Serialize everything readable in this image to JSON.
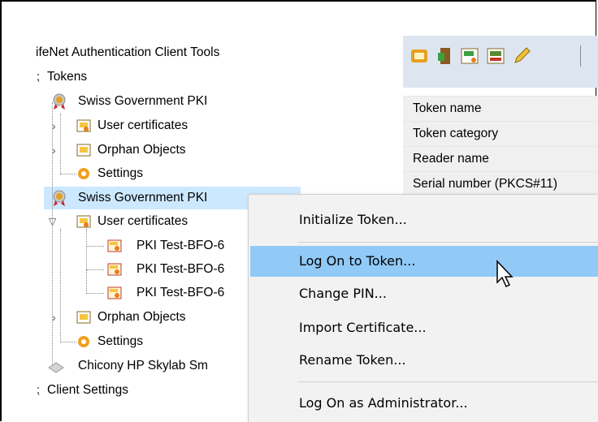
{
  "tree": {
    "root_label": "ifeNet Authentication Client Tools",
    "tokens_label": "Tokens",
    "token1": {
      "label": "Swiss Government PKI",
      "user_certs": "User certificates",
      "orphan": "Orphan Objects",
      "settings": "Settings"
    },
    "token2": {
      "label": "Swiss Government PKI",
      "user_certs": "User certificates",
      "certs": [
        "PKI Test-BFO-6",
        "PKI Test-BFO-6",
        "PKI Test-BFO-6"
      ],
      "orphan": "Orphan Objects",
      "settings": "Settings"
    },
    "reader_label": "Chicony HP Skylab Sm",
    "client_settings": "Client Settings"
  },
  "properties": {
    "rows": [
      "Token name",
      "Token category",
      "Reader name",
      "Serial number (PKCS#11)"
    ]
  },
  "context_menu": {
    "items": [
      "Initialize Token...",
      "Log On to Token...",
      "Change PIN...",
      "Import Certificate...",
      "Rename Token...",
      "Log On as Administrator..."
    ],
    "hovered_index": 1
  },
  "colors": {
    "selection": "#cce8ff",
    "menu_hover": "#91c9f7",
    "toolbar_bg": "#dde6f0"
  }
}
